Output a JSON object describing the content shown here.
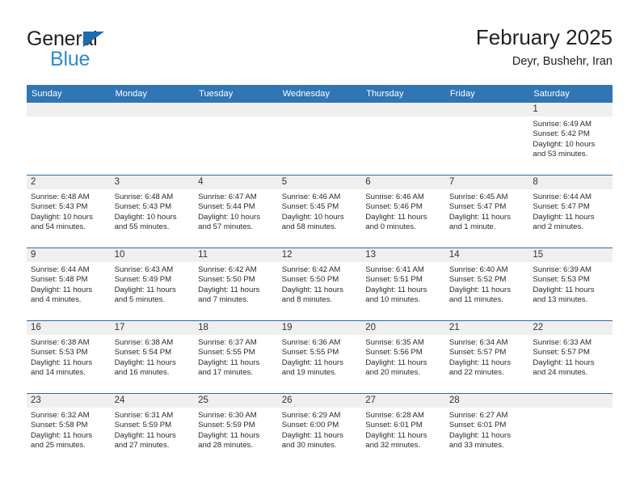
{
  "brand": {
    "line1": "General",
    "line2": "Blue",
    "triangle_color": "#1b6cb0",
    "line2_color": "#2e8ad6"
  },
  "header": {
    "title": "February 2025",
    "subtitle": "Deyr, Bushehr, Iran",
    "accent_color": "#3075b4"
  },
  "calendar": {
    "weekday_headers": [
      "Sunday",
      "Monday",
      "Tuesday",
      "Wednesday",
      "Thursday",
      "Friday",
      "Saturday"
    ],
    "weeks": [
      [
        {
          "day": "",
          "empty": true
        },
        {
          "day": "",
          "empty": true
        },
        {
          "day": "",
          "empty": true
        },
        {
          "day": "",
          "empty": true
        },
        {
          "day": "",
          "empty": true
        },
        {
          "day": "",
          "empty": true
        },
        {
          "day": "1",
          "sunrise": "Sunrise: 6:49 AM",
          "sunset": "Sunset: 5:42 PM",
          "daylight_line1": "Daylight: 10 hours",
          "daylight_line2": "and 53 minutes."
        }
      ],
      [
        {
          "day": "2",
          "sunrise": "Sunrise: 6:48 AM",
          "sunset": "Sunset: 5:43 PM",
          "daylight_line1": "Daylight: 10 hours",
          "daylight_line2": "and 54 minutes."
        },
        {
          "day": "3",
          "sunrise": "Sunrise: 6:48 AM",
          "sunset": "Sunset: 5:43 PM",
          "daylight_line1": "Daylight: 10 hours",
          "daylight_line2": "and 55 minutes."
        },
        {
          "day": "4",
          "sunrise": "Sunrise: 6:47 AM",
          "sunset": "Sunset: 5:44 PM",
          "daylight_line1": "Daylight: 10 hours",
          "daylight_line2": "and 57 minutes."
        },
        {
          "day": "5",
          "sunrise": "Sunrise: 6:46 AM",
          "sunset": "Sunset: 5:45 PM",
          "daylight_line1": "Daylight: 10 hours",
          "daylight_line2": "and 58 minutes."
        },
        {
          "day": "6",
          "sunrise": "Sunrise: 6:46 AM",
          "sunset": "Sunset: 5:46 PM",
          "daylight_line1": "Daylight: 11 hours",
          "daylight_line2": "and 0 minutes."
        },
        {
          "day": "7",
          "sunrise": "Sunrise: 6:45 AM",
          "sunset": "Sunset: 5:47 PM",
          "daylight_line1": "Daylight: 11 hours",
          "daylight_line2": "and 1 minute."
        },
        {
          "day": "8",
          "sunrise": "Sunrise: 6:44 AM",
          "sunset": "Sunset: 5:47 PM",
          "daylight_line1": "Daylight: 11 hours",
          "daylight_line2": "and 2 minutes."
        }
      ],
      [
        {
          "day": "9",
          "sunrise": "Sunrise: 6:44 AM",
          "sunset": "Sunset: 5:48 PM",
          "daylight_line1": "Daylight: 11 hours",
          "daylight_line2": "and 4 minutes."
        },
        {
          "day": "10",
          "sunrise": "Sunrise: 6:43 AM",
          "sunset": "Sunset: 5:49 PM",
          "daylight_line1": "Daylight: 11 hours",
          "daylight_line2": "and 5 minutes."
        },
        {
          "day": "11",
          "sunrise": "Sunrise: 6:42 AM",
          "sunset": "Sunset: 5:50 PM",
          "daylight_line1": "Daylight: 11 hours",
          "daylight_line2": "and 7 minutes."
        },
        {
          "day": "12",
          "sunrise": "Sunrise: 6:42 AM",
          "sunset": "Sunset: 5:50 PM",
          "daylight_line1": "Daylight: 11 hours",
          "daylight_line2": "and 8 minutes."
        },
        {
          "day": "13",
          "sunrise": "Sunrise: 6:41 AM",
          "sunset": "Sunset: 5:51 PM",
          "daylight_line1": "Daylight: 11 hours",
          "daylight_line2": "and 10 minutes."
        },
        {
          "day": "14",
          "sunrise": "Sunrise: 6:40 AM",
          "sunset": "Sunset: 5:52 PM",
          "daylight_line1": "Daylight: 11 hours",
          "daylight_line2": "and 11 minutes."
        },
        {
          "day": "15",
          "sunrise": "Sunrise: 6:39 AM",
          "sunset": "Sunset: 5:53 PM",
          "daylight_line1": "Daylight: 11 hours",
          "daylight_line2": "and 13 minutes."
        }
      ],
      [
        {
          "day": "16",
          "sunrise": "Sunrise: 6:38 AM",
          "sunset": "Sunset: 5:53 PM",
          "daylight_line1": "Daylight: 11 hours",
          "daylight_line2": "and 14 minutes."
        },
        {
          "day": "17",
          "sunrise": "Sunrise: 6:38 AM",
          "sunset": "Sunset: 5:54 PM",
          "daylight_line1": "Daylight: 11 hours",
          "daylight_line2": "and 16 minutes."
        },
        {
          "day": "18",
          "sunrise": "Sunrise: 6:37 AM",
          "sunset": "Sunset: 5:55 PM",
          "daylight_line1": "Daylight: 11 hours",
          "daylight_line2": "and 17 minutes."
        },
        {
          "day": "19",
          "sunrise": "Sunrise: 6:36 AM",
          "sunset": "Sunset: 5:55 PM",
          "daylight_line1": "Daylight: 11 hours",
          "daylight_line2": "and 19 minutes."
        },
        {
          "day": "20",
          "sunrise": "Sunrise: 6:35 AM",
          "sunset": "Sunset: 5:56 PM",
          "daylight_line1": "Daylight: 11 hours",
          "daylight_line2": "and 20 minutes."
        },
        {
          "day": "21",
          "sunrise": "Sunrise: 6:34 AM",
          "sunset": "Sunset: 5:57 PM",
          "daylight_line1": "Daylight: 11 hours",
          "daylight_line2": "and 22 minutes."
        },
        {
          "day": "22",
          "sunrise": "Sunrise: 6:33 AM",
          "sunset": "Sunset: 5:57 PM",
          "daylight_line1": "Daylight: 11 hours",
          "daylight_line2": "and 24 minutes."
        }
      ],
      [
        {
          "day": "23",
          "sunrise": "Sunrise: 6:32 AM",
          "sunset": "Sunset: 5:58 PM",
          "daylight_line1": "Daylight: 11 hours",
          "daylight_line2": "and 25 minutes."
        },
        {
          "day": "24",
          "sunrise": "Sunrise: 6:31 AM",
          "sunset": "Sunset: 5:59 PM",
          "daylight_line1": "Daylight: 11 hours",
          "daylight_line2": "and 27 minutes."
        },
        {
          "day": "25",
          "sunrise": "Sunrise: 6:30 AM",
          "sunset": "Sunset: 5:59 PM",
          "daylight_line1": "Daylight: 11 hours",
          "daylight_line2": "and 28 minutes."
        },
        {
          "day": "26",
          "sunrise": "Sunrise: 6:29 AM",
          "sunset": "Sunset: 6:00 PM",
          "daylight_line1": "Daylight: 11 hours",
          "daylight_line2": "and 30 minutes."
        },
        {
          "day": "27",
          "sunrise": "Sunrise: 6:28 AM",
          "sunset": "Sunset: 6:01 PM",
          "daylight_line1": "Daylight: 11 hours",
          "daylight_line2": "and 32 minutes."
        },
        {
          "day": "28",
          "sunrise": "Sunrise: 6:27 AM",
          "sunset": "Sunset: 6:01 PM",
          "daylight_line1": "Daylight: 11 hours",
          "daylight_line2": "and 33 minutes."
        },
        {
          "day": "",
          "empty": true
        }
      ]
    ]
  }
}
